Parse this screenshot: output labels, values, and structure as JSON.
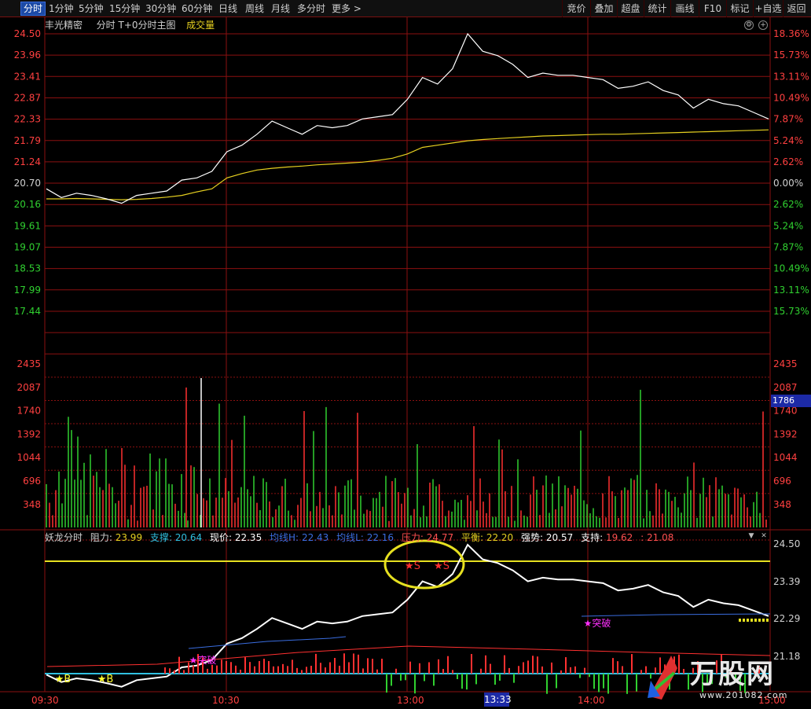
{
  "toolbar": {
    "periods": [
      "分时",
      "1分钟",
      "5分钟",
      "15分钟",
      "30分钟",
      "60分钟",
      "日线",
      "周线",
      "月线",
      "多分时",
      "更多 >"
    ],
    "active_period": "分时",
    "right_buttons": [
      "竞价",
      "叠加",
      "超盘",
      "统计",
      "画线",
      "F10",
      "标记",
      "+自选",
      "返回"
    ]
  },
  "header": {
    "stock_name": "丰光精密",
    "mode": "分时  T+0分时主图",
    "volume_label": "成交量"
  },
  "indicator": {
    "name": "妖龙分时",
    "resistance_label": "阻力:",
    "resistance": "23.99",
    "support_label": "支撑:",
    "support": "20.64",
    "price_label": "现价:",
    "price": "22.35",
    "avg_h_label": "均线H:",
    "avg_h": "22.43",
    "avg_l_label": "均线L:",
    "avg_l": "22.16",
    "pressure_label": "压力:",
    "pressure": "24.77",
    "balance_label": "平衡:",
    "balance": "22.20",
    "strength_label": "强势:",
    "strength": "20.57",
    "hold_label": "支持:",
    "hold": "19.62",
    "extra": ": 21.08",
    "ticks": [
      "24.50",
      "23.39",
      "22.29",
      "21.18"
    ],
    "buy_markers": [
      "B",
      "B"
    ],
    "sell_markers": [
      "S",
      "S"
    ],
    "breakout_label": "突破"
  },
  "price_axis": {
    "left": [
      "24.50",
      "23.96",
      "23.41",
      "22.87",
      "22.33",
      "21.79",
      "21.24",
      "20.70",
      "20.16",
      "19.61",
      "19.07",
      "18.53",
      "17.99",
      "17.44"
    ],
    "right": [
      "18.36%",
      "15.73%",
      "13.11%",
      "10.49%",
      "7.87%",
      "5.24%",
      "2.62%",
      "0.00%",
      "2.62%",
      "5.24%",
      "7.87%",
      "10.49%",
      "13.11%",
      "15.73%"
    ]
  },
  "volume_axis": [
    "2435",
    "2087",
    "1740",
    "1392",
    "1044",
    "696",
    "348"
  ],
  "current_volume": "1786",
  "time_axis": [
    "09:30",
    "10:30",
    "13:00",
    "14:00",
    "15:00"
  ],
  "cursor_time": "13:33",
  "watermark": {
    "text": "万股网",
    "url": "www.201082.com"
  },
  "colors": {
    "up": "#ff3030",
    "down": "#30d030",
    "price_line": "#ffffff",
    "avg_line": "#e6d020",
    "grid": "#8b1010"
  },
  "chart_data": {
    "type": "line",
    "prev_close": 20.7,
    "ylim": [
      17.17,
      24.5
    ],
    "x": [
      "09:30",
      "09:35",
      "09:40",
      "09:45",
      "09:50",
      "09:55",
      "10:00",
      "10:05",
      "10:10",
      "10:15",
      "10:20",
      "10:25",
      "10:30",
      "10:35",
      "10:40",
      "10:45",
      "10:50",
      "10:55",
      "11:00",
      "11:05",
      "11:10",
      "11:15",
      "11:20",
      "11:25",
      "11:30",
      "13:05",
      "13:10",
      "13:15",
      "13:20",
      "13:25",
      "13:30",
      "13:35",
      "13:40",
      "13:45",
      "13:50",
      "13:55",
      "14:00",
      "14:05",
      "14:10",
      "14:15",
      "14:20",
      "14:25",
      "14:30",
      "14:35",
      "14:40",
      "14:45",
      "14:50",
      "14:55",
      "15:00"
    ],
    "series": [
      {
        "values": [
          20.95,
          20.75,
          20.85,
          20.8,
          20.72,
          20.62,
          20.8,
          20.85,
          20.9,
          21.15,
          21.2,
          21.35,
          21.8,
          21.95,
          22.2,
          22.5,
          22.35,
          22.2,
          22.4,
          22.35,
          22.4,
          22.55,
          22.6,
          22.65,
          23.0,
          23.5,
          23.35,
          23.7,
          24.5,
          24.1,
          24.0,
          23.8,
          23.5,
          23.6,
          23.55,
          23.55,
          23.5,
          23.45,
          23.25,
          23.3,
          23.4,
          23.2,
          23.1,
          22.8,
          23.0,
          22.9,
          22.85,
          22.7,
          22.55
        ]
      },
      {
        "values": [
          20.72,
          20.72,
          20.73,
          20.72,
          20.71,
          20.7,
          20.71,
          20.73,
          20.76,
          20.8,
          20.88,
          20.95,
          21.2,
          21.3,
          21.38,
          21.42,
          21.45,
          21.47,
          21.5,
          21.52,
          21.54,
          21.56,
          21.6,
          21.65,
          21.75,
          21.9,
          21.95,
          22.0,
          22.05,
          22.08,
          22.1,
          22.12,
          22.14,
          22.16,
          22.17,
          22.18,
          22.19,
          22.2,
          22.2,
          22.21,
          22.22,
          22.23,
          22.24,
          22.25,
          22.26,
          22.27,
          22.28,
          22.29,
          22.3
        ]
      }
    ]
  }
}
